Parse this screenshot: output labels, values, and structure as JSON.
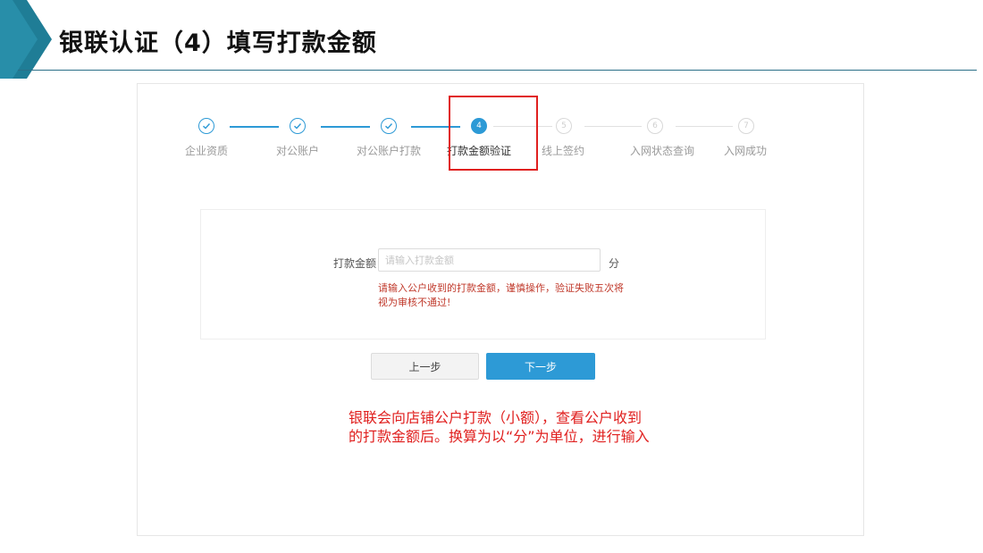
{
  "slide": {
    "title": "银联认证（4）填写打款金额",
    "accent_color": "#2b6f87"
  },
  "stepper": {
    "steps": [
      {
        "label": "企业资质",
        "status": "done",
        "icon": "check-icon"
      },
      {
        "label": "对公账户",
        "status": "done",
        "icon": "check-icon"
      },
      {
        "label": "对公账户打款",
        "status": "done",
        "icon": "check-icon"
      },
      {
        "label": "打款金额验证",
        "status": "active",
        "number": "4"
      },
      {
        "label": "线上签约",
        "status": "todo",
        "number": "5"
      },
      {
        "label": "入网状态查询",
        "status": "todo",
        "number": "6"
      },
      {
        "label": "入网成功",
        "status": "todo",
        "number": "7"
      }
    ],
    "active_color": "#2d9ad6",
    "highlight_color": "#e0201f"
  },
  "form": {
    "amount_label": "打款金额",
    "amount_placeholder": "请输入打款金额",
    "amount_value": "",
    "unit": "分",
    "hint": "请输入公户收到的打款金额，谨慎操作，验证失败五次将视为审核不通过!"
  },
  "buttons": {
    "prev_label": "上一步",
    "next_label": "下一步"
  },
  "annotation": {
    "text": "银联会向店铺公户打款（小额），查看公户收到的打款金额后。换算为以“分”为单位，进行输入",
    "color": "#e0201f"
  }
}
